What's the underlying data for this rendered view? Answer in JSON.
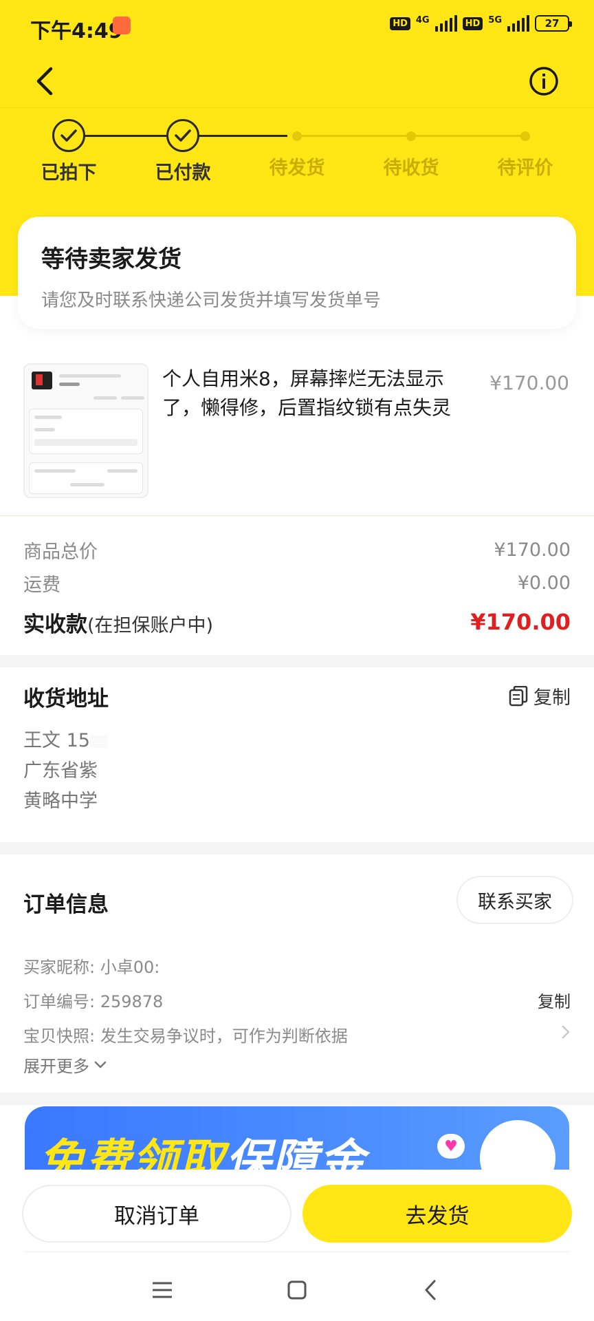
{
  "status_bar": {
    "time": "下午4:49",
    "hd1": "HD",
    "net1": "4G",
    "hd2": "HD",
    "net2": "5G",
    "battery": "27"
  },
  "icons": {
    "back": "chevron-left-icon",
    "info": "info-circle-icon",
    "copy": "document-copy-icon",
    "expand": "chevron-down-icon",
    "snapshot": "chevron-right-icon"
  },
  "steps": [
    {
      "label": "已拍下",
      "state": "done"
    },
    {
      "label": "已付款",
      "state": "done"
    },
    {
      "label": "待发货",
      "state": "pending"
    },
    {
      "label": "待收货",
      "state": "pending"
    },
    {
      "label": "待评价",
      "state": "pending"
    }
  ],
  "status_card": {
    "title": "等待卖家发货",
    "subtitle": "请您及时联系快递公司发货并填写发货单号"
  },
  "product": {
    "title": "个人自用米8，屏幕摔烂无法显示了，懒得修，后置指纹锁有点失灵",
    "price": "¥170.00"
  },
  "summary": {
    "goods_label": "商品总价",
    "goods_value": "¥170.00",
    "shipping_label": "运费",
    "shipping_value": "¥0.00",
    "total_label": "实收款",
    "total_note": "(在担保账户中)",
    "total_value": "¥170.00"
  },
  "address": {
    "title": "收货地址",
    "copy_label": "复制",
    "name_line": "王文 15",
    "region_line": "广东省紫",
    "detail_line": "黄略中学"
  },
  "order_info": {
    "title": "订单信息",
    "contact_button": "联系买家",
    "buyer_label": "买家昵称: 小卓00:",
    "order_no_label": "订单编号: 259878",
    "order_copy": "复制",
    "snapshot_label": "宝贝快照: 发生交易争议时，可作为判断依据",
    "expand_label": "展开更多"
  },
  "banner": {
    "text_yellow": "免费领取",
    "text_white": "保障金"
  },
  "actions": {
    "cancel": "取消订单",
    "ship": "去发货"
  },
  "colors": {
    "brand_yellow": "#FFE614",
    "price_red": "#e02020",
    "banner_blue": "#3a78ff"
  }
}
